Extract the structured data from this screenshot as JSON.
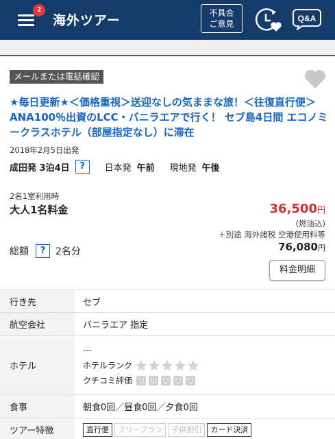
{
  "header": {
    "menu_badge": "2",
    "title": "海外ツアー",
    "report_line1": "不具合",
    "report_line2": "ご意見",
    "qa_label": "Q&A"
  },
  "tour": {
    "confirm_tag": "メールまたは電話確認",
    "title": "★毎日更新★＜価格重視＞送迎なしの気ままな旅！＜往復直行便＞ANA100％出資のLCC・バニラエアで行く！ セブ島4日間 エコノミークラスホテル（部屋指定なし）に滞在",
    "depart_date": "2018年2月5日出発",
    "origin_days": "成田発 3泊4日",
    "help_q": "?",
    "japan_dep_label": "日本発",
    "japan_dep_value": "午前",
    "local_dep_label": "現地発",
    "local_dep_value": "午後"
  },
  "pricing": {
    "room_note": "2名1室利用時",
    "adult_label": "大人1名料金",
    "price": "36,500",
    "yen": "円",
    "fuel_note": "(燃油込)",
    "tax_note": "＋別途 海外諸税 空港使用料等",
    "total_label": "総額",
    "total_q": "?",
    "total_people": "2名分",
    "total_price": "76,080",
    "detail_button": "料金明細"
  },
  "info": {
    "destination_label": "行き先",
    "destination_value": "セブ",
    "airline_label": "航空会社",
    "airline_value": "バニラエア 指定",
    "hotel_label": "ホテル",
    "hotel_name": "---",
    "hotel_rank_label": "ホテルランク",
    "hotel_rank_stars": 0,
    "review_label": "クチコミ評価",
    "review_score": 0,
    "meals_label": "食事",
    "meals_value": "朝食0回／昼食0回／夕食0回",
    "features_label": "ツアー特徴",
    "features": [
      {
        "label": "直行便",
        "active": true
      },
      {
        "label": "フリープラン",
        "active": false
      },
      {
        "label": "子供割引",
        "active": false
      },
      {
        "label": "カード決済",
        "active": true
      }
    ]
  },
  "colors": {
    "header_bg": "#143b6a",
    "title_blue": "#1565c0",
    "price_red": "#d32f2f",
    "badge_red": "#e23a3a"
  }
}
